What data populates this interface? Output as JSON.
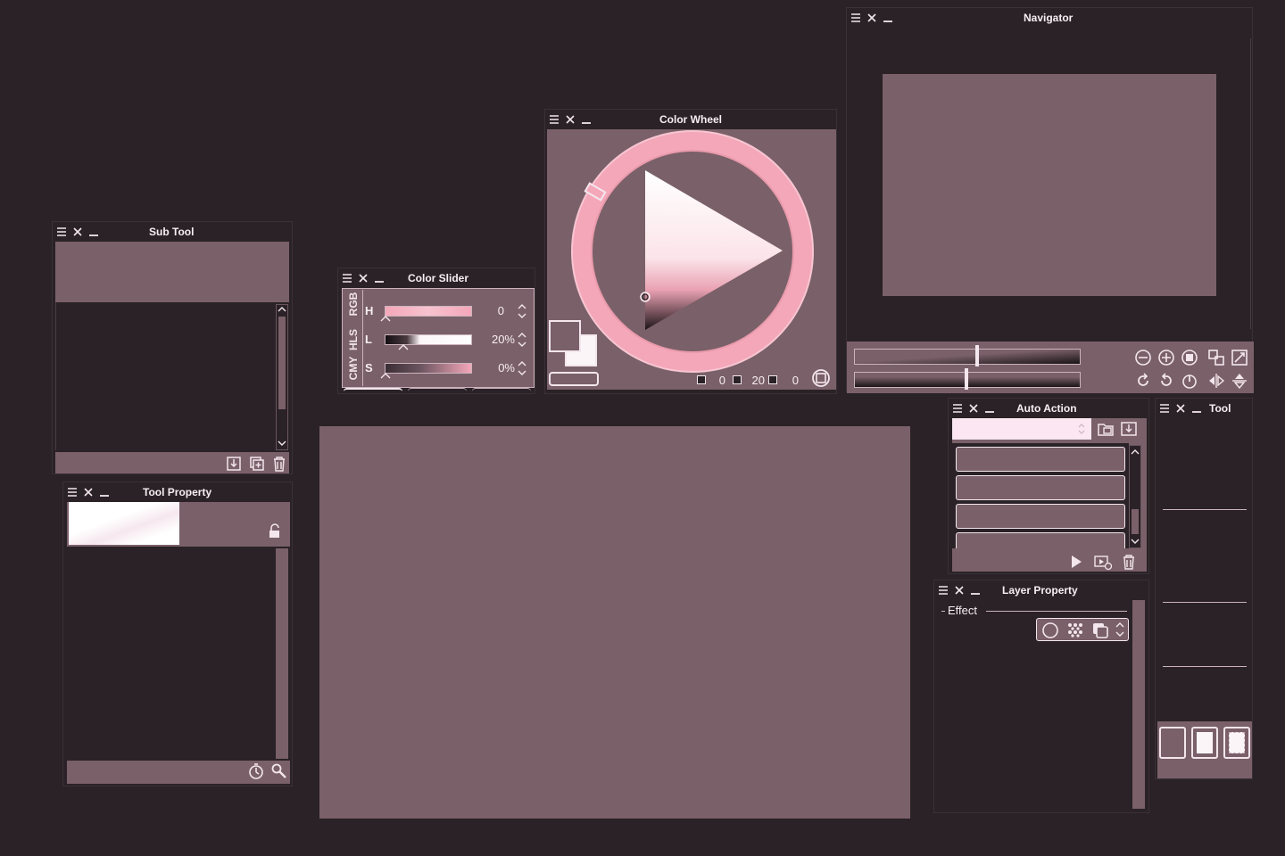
{
  "panels": {
    "navigator": {
      "title": "Navigator"
    },
    "color_wheel": {
      "title": "Color Wheel",
      "readout": {
        "h_value": "0",
        "l_value": "20",
        "s_value": "0"
      }
    },
    "sub_tool": {
      "title": "Sub Tool"
    },
    "color_slider": {
      "title": "Color Slider",
      "tabs": [
        "RGB",
        "HLS",
        "CMY"
      ],
      "rows": [
        {
          "label": "H",
          "value": "0"
        },
        {
          "label": "L",
          "value": "20%"
        },
        {
          "label": "S",
          "value": "0%"
        }
      ]
    },
    "tool_property": {
      "title": "Tool Property"
    },
    "auto_action": {
      "title": "Auto Action"
    },
    "tool": {
      "title": "Tool"
    },
    "layer_property": {
      "title": "Layer Property",
      "section": "Effect"
    }
  },
  "colors": {
    "bg": "#2a2226",
    "mauve": "#7a6069",
    "accent": "#f4a7b9",
    "text": "#f6eef2"
  }
}
